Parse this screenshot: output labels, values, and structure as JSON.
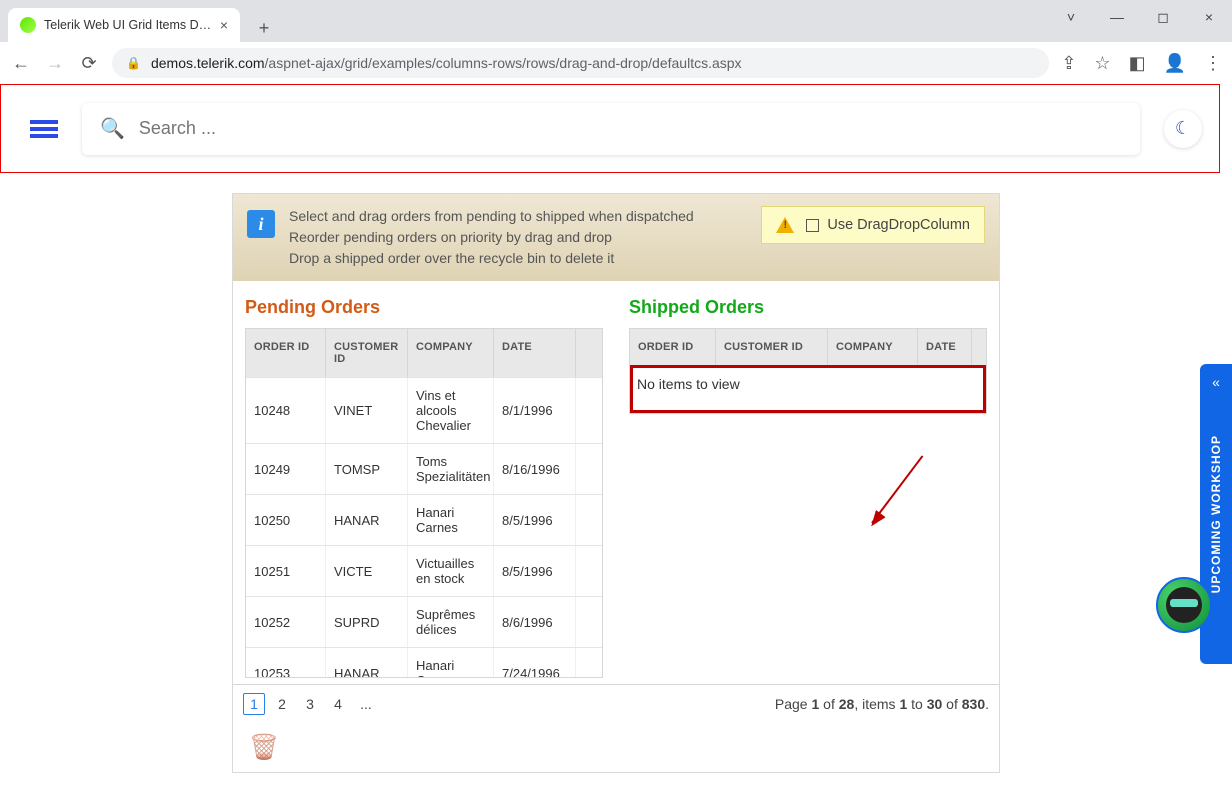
{
  "browser": {
    "tab_title": "Telerik Web UI Grid Items Drag-a",
    "url_host": "demos.telerik.com",
    "url_path": "/aspnet-ajax/grid/examples/columns-rows/rows/drag-and-drop/defaultcs.aspx"
  },
  "search": {
    "placeholder": "Search ..."
  },
  "banner": {
    "line1": "Select and drag orders from pending to shipped when dispatched",
    "line2": "Reorder pending orders on priority by drag and drop",
    "line3": "Drop a shipped order over the recycle bin to delete it",
    "checkbox_label": "Use DragDropColumn"
  },
  "pending": {
    "title": "Pending Orders",
    "headers": {
      "order": "ORDER ID",
      "cust": "CUSTOMER ID",
      "comp": "COMPANY",
      "date": "DATE"
    },
    "rows": [
      {
        "order": "10248",
        "cust": "VINET",
        "comp": "Vins et alcools Chevalier",
        "date": "8/1/1996"
      },
      {
        "order": "10249",
        "cust": "TOMSP",
        "comp": "Toms Spezialitäten",
        "date": "8/16/1996"
      },
      {
        "order": "10250",
        "cust": "HANAR",
        "comp": "Hanari Carnes",
        "date": "8/5/1996"
      },
      {
        "order": "10251",
        "cust": "VICTE",
        "comp": "Victuailles en stock",
        "date": "8/5/1996"
      },
      {
        "order": "10252",
        "cust": "SUPRD",
        "comp": "Suprêmes délices",
        "date": "8/6/1996"
      },
      {
        "order": "10253",
        "cust": "HANAR",
        "comp": "Hanari Carnes",
        "date": "7/24/1996"
      }
    ],
    "pager": {
      "pages": [
        "1",
        "2",
        "3",
        "4",
        "..."
      ],
      "active": "1",
      "summary_1": "Page ",
      "summary_2": "1",
      "summary_3": " of ",
      "summary_4": "28",
      "summary_5": ", items ",
      "summary_6": "1",
      "summary_7": " to ",
      "summary_8": "30",
      "summary_9": " of ",
      "summary_10": "830",
      "summary_11": "."
    }
  },
  "shipped": {
    "title": "Shipped Orders",
    "headers": {
      "order": "ORDER ID",
      "cust": "CUSTOMER ID",
      "comp": "COMPANY",
      "date": "DATE"
    },
    "empty": "No items to view"
  },
  "sidepanel": {
    "label": "UPCOMING WORKSHOP"
  }
}
